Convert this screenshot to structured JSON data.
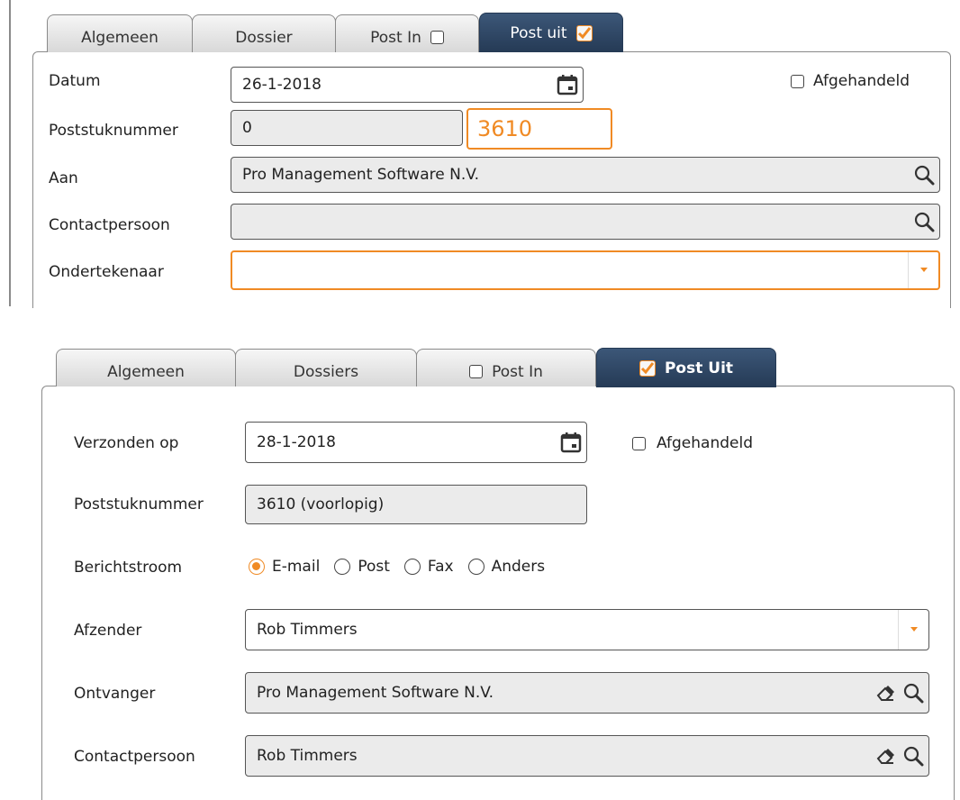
{
  "top": {
    "tabs": [
      {
        "label": "Algemeen"
      },
      {
        "label": "Dossier"
      },
      {
        "label": "Post In"
      },
      {
        "label": "Post uit"
      }
    ],
    "datum_label": "Datum",
    "datum_value": "26-1-2018",
    "afgehandeld_label": "Afgehandeld",
    "poststuknummer_label": "Poststuknummer",
    "poststuknummer_value": "0",
    "poststuknummer_highlight": "3610",
    "aan_label": "Aan",
    "aan_value": "Pro Management Software N.V.",
    "contactpersoon_label": "Contactpersoon",
    "contactpersoon_value": "",
    "ondertekenaar_label": "Ondertekenaar",
    "ondertekenaar_value": ""
  },
  "bottom": {
    "tabs": [
      {
        "label": "Algemeen"
      },
      {
        "label": "Dossiers"
      },
      {
        "label": "Post In"
      },
      {
        "label": "Post Uit"
      }
    ],
    "verzonden_label": "Verzonden op",
    "verzonden_value": "28-1-2018",
    "afgehandeld_label": "Afgehandeld",
    "poststuknummer_label": "Poststuknummer",
    "poststuknummer_value": "3610 (voorlopig)",
    "berichtstroom_label": "Berichtstroom",
    "berichtstroom_options": [
      "E-mail",
      "Post",
      "Fax",
      "Anders"
    ],
    "berichtstroom_selected": "E-mail",
    "afzender_label": "Afzender",
    "afzender_value": "Rob Timmers",
    "ontvanger_label": "Ontvanger",
    "ontvanger_value": "Pro Management Software N.V.",
    "contactpersoon_label": "Contactpersoon",
    "contactpersoon_value": "Rob Timmers"
  },
  "colors": {
    "accent": "#f08a24",
    "tab_active": "#2d4563",
    "field_gray": "#ebebeb"
  },
  "icons": [
    "calendar-icon",
    "search-icon",
    "eraser-icon",
    "dropdown-arrow-icon",
    "checkbox-checked-icon"
  ]
}
